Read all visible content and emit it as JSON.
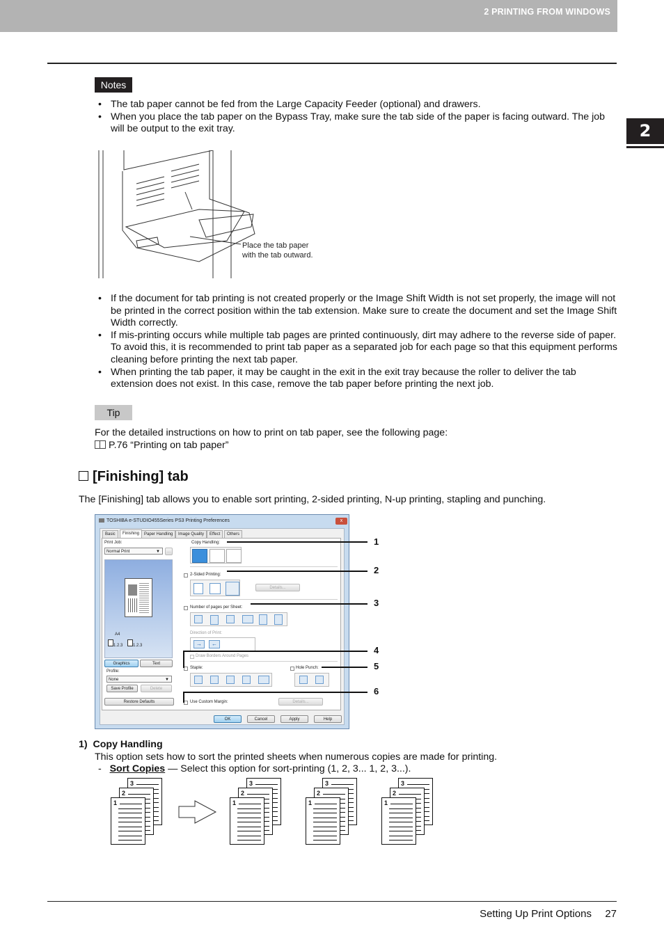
{
  "header": {
    "chapter_title": "2 PRINTING FROM WINDOWS",
    "chapter_tab": "2"
  },
  "notes": {
    "label": "Notes",
    "items_top": [
      "The tab paper cannot be fed from the Large Capacity Feeder (optional) and drawers.",
      "When you place the tab paper on the Bypass Tray, make sure the tab side of the paper is facing outward. The job will be output to the exit tray."
    ],
    "illustration_caption_line1": "Place the tab paper",
    "illustration_caption_line2": "with the tab outward.",
    "items_bottom": [
      "If the document for tab printing is not created properly or the Image Shift Width is not set properly, the image will not be printed in the correct position within the tab extension. Make sure to create the document and set the Image Shift Width correctly.",
      "If mis-printing occurs while multiple tab pages are printed continuously, dirt may adhere to the reverse side of paper. To avoid this, it is recommended to print tab paper as a separated job for each page so that this equipment performs cleaning before printing the next tab paper.",
      "When printing the tab paper, it may be caught in the exit in the exit tray because the roller to deliver the tab extension does not exist. In this case, remove the tab paper before printing the next job."
    ]
  },
  "tip": {
    "label": "Tip",
    "text": "For the detailed instructions on how to print on tab paper, see the following page:",
    "link_icon": "book-icon",
    "link_text": "P.76 “Printing on tab paper”"
  },
  "section": {
    "title": "[Finishing] tab",
    "intro": "The [Finishing] tab allows you to enable sort printing, 2-sided printing, N-up printing, stapling and punching."
  },
  "dialog": {
    "title": "TOSHIBA e-STUDIO455Series PS3 Printing Preferences",
    "close": "x",
    "tabs": [
      "Basic",
      "Finishing",
      "Paper Handling",
      "Image Quality",
      "Effect",
      "Others"
    ],
    "active_tab": "Finishing",
    "print_job_label": "Print Job:",
    "print_job_value": "Normal Print",
    "print_job_more": "...",
    "preview_paper": "A4",
    "preview_order_1": "1.2.3",
    "preview_order_2": "1.2.3",
    "graphics_button": "Graphics",
    "text_button": "Text",
    "profile_label": "Profile:",
    "profile_value": "None",
    "save_profile_button": "Save Profile",
    "delete_button": "Delete",
    "restore_defaults_button": "Restore Defaults",
    "copy_handling_label": "Copy Handling:",
    "copy_handling_options": [
      "1.2.3",
      "1.1.1",
      "1.2.3"
    ],
    "two_sided_label": "2-Sided Printing:",
    "two_sided_details": "Details...",
    "nup_label": "Number of pages per Sheet:",
    "nup_options": [
      "2",
      "4",
      "6",
      "8",
      "9",
      "16"
    ],
    "direction_label": "Direction of Print:",
    "draw_borders_label": "Draw Borders Around Pages",
    "staple_label": "Staple:",
    "hole_punch_label": "Hole Punch:",
    "custom_margin_label": "Use Custom Margin:",
    "custom_margin_details": "Details...",
    "ok_button": "OK",
    "cancel_button": "Cancel",
    "apply_button": "Apply",
    "help_button": "Help",
    "callouts": [
      "1",
      "2",
      "3",
      "4",
      "5",
      "6"
    ]
  },
  "copy_handling": {
    "heading_num": "1)",
    "heading": "Copy Handling",
    "desc": "This option sets how to sort the printed sheets when numerous copies are made for printing.",
    "dash": "-",
    "option_name": "Sort Copies",
    "option_desc": " — Select this option for sort-printing (1, 2, 3... 1, 2, 3...).",
    "sheet_numbers": [
      "1",
      "2",
      "3"
    ]
  },
  "footer": {
    "section": "Setting Up Print Options",
    "page": "27"
  }
}
